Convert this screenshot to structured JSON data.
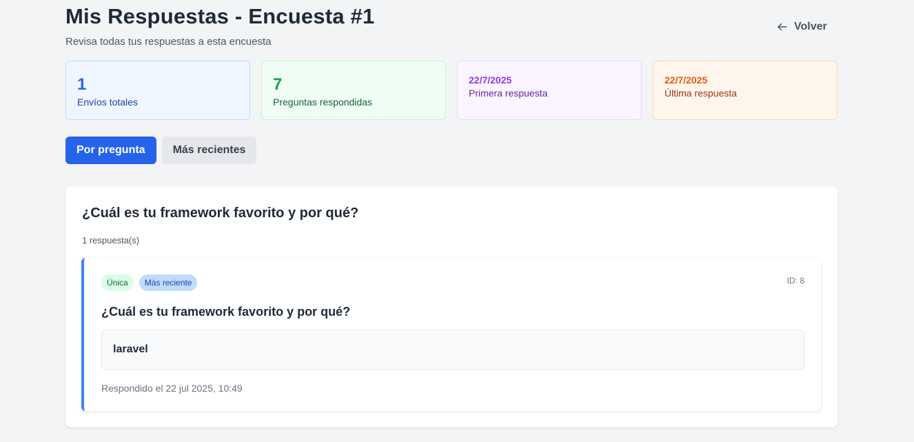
{
  "header": {
    "title": "Mis Respuestas - Encuesta #1",
    "subtitle": "Revisa todas tus respuestas a esta encuesta",
    "back_label": "Volver"
  },
  "stats": [
    {
      "value": "1",
      "label": "Envíos totales",
      "color": "#2563eb"
    },
    {
      "value": "7",
      "label": "Preguntas respondidas",
      "color": "#16a34a"
    },
    {
      "value": "22/7/2025",
      "label": "Primera respuesta",
      "color": "#9333ea"
    },
    {
      "value": "22/7/2025",
      "label": "Última respuesta",
      "color": "#ea580c"
    }
  ],
  "tabs": [
    {
      "label": "Por pregunta",
      "active": true
    },
    {
      "label": "Más recientes",
      "active": false
    }
  ],
  "question_card": {
    "title": "¿Cuál es tu framework favorito y por qué?",
    "count": "1 respuesta(s)",
    "answers": [
      {
        "badges": [
          "Única",
          "Más reciente"
        ],
        "id": "ID: 8",
        "question": "¿Cuál es tu framework favorito y por qué?",
        "response": "laravel",
        "answered_at": "Respondido el 22 jul 2025, 10:49"
      }
    ]
  },
  "colors": {
    "primary": "#2563eb",
    "background": "#f3f4f6",
    "accent_border": "#3b82f6"
  }
}
